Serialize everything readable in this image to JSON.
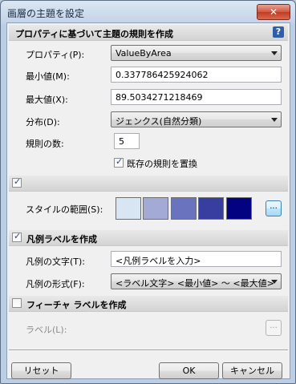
{
  "window": {
    "title": "画層の主題を設定",
    "close_glyph": "✕"
  },
  "header": {
    "title": "プロパティに基づいて主題の規則を作成",
    "help_glyph": "?"
  },
  "property": {
    "label": "プロパティ(P):",
    "value": "ValueByArea"
  },
  "min": {
    "label": "最小値(M):",
    "value": "0.337786425924062"
  },
  "max": {
    "label": "最大値(X):",
    "value": "89.5034271218469"
  },
  "distribution": {
    "label": "分布(D):",
    "value": "ジェンクス(自然分類)"
  },
  "rule_count": {
    "label": "規則の数:",
    "value": "5"
  },
  "replace_rules": {
    "label": "既存の規則を置換",
    "checked": true
  },
  "style_section": {
    "checked": true
  },
  "style_range": {
    "label": "スタイルの範囲(S):",
    "swatches": [
      "#d8e6f3",
      "#a3aad5",
      "#6a73be",
      "#383ea0",
      "#030382"
    ],
    "button": "..."
  },
  "legend_section": {
    "title": "凡例ラベルを作成",
    "checked": true
  },
  "legend_text": {
    "label": "凡例の文字(T):",
    "value": "<凡例ラベルを入力>"
  },
  "legend_format": {
    "label": "凡例の形式(F):",
    "value": "<ラベル文字> <最小値> ～ <最大値>"
  },
  "feature_section": {
    "title": "フィーチャ ラベルを作成",
    "checked": false
  },
  "feature_label": {
    "label": "ラベル(L):",
    "button": "..."
  },
  "buttons": {
    "reset": "リセット",
    "ok": "OK",
    "cancel": "キャンセル"
  }
}
